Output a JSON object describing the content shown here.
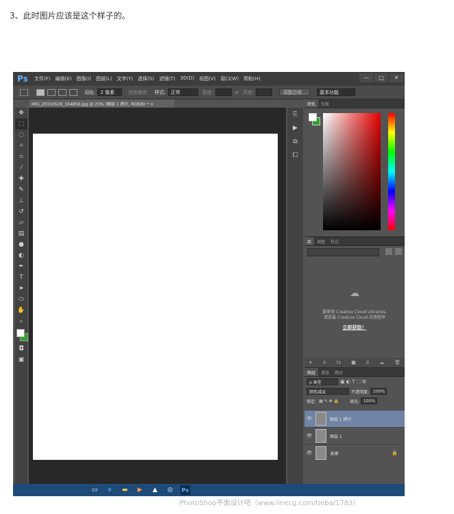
{
  "caption": "3、此时图片应该是这个样子的。",
  "app": {
    "logo": "Ps",
    "menu": [
      "文件(F)",
      "编辑(E)",
      "图像(I)",
      "图层(L)",
      "文字(Y)",
      "选择(S)",
      "滤镜(T)",
      "3D(D)",
      "视图(V)",
      "窗口(W)",
      "帮助(H)"
    ],
    "window_controls": [
      "—",
      "□",
      "✕"
    ]
  },
  "options_bar": {
    "feather_label": "羽化:",
    "feather_value": "2 像素",
    "antialias_label": "消除锯齿",
    "style_label": "样式:",
    "style_value": "正常",
    "width_label": "宽度:",
    "height_label": "高度:",
    "refine_edge": "调整边缘...",
    "workspace": "基本功能"
  },
  "document_tab": "IMG_20150526_164858.jpg @ 25% (图层 1 拷贝, RGB/8) * ×",
  "color_panel": {
    "tabs": [
      "颜色",
      "色板"
    ],
    "fg_color": "#ffffff",
    "bg_color": "#2fa32f"
  },
  "library_panel": {
    "tabs": [
      "库",
      "调整",
      "样式"
    ],
    "message_line1": "要使用 Creative Cloud Libraries,",
    "message_line2": "请安装 Creative Cloud 应用程序",
    "link": "立即获取！"
  },
  "layers_panel": {
    "tabs": [
      "图层",
      "通道",
      "路径"
    ],
    "filter_kind": "ρ 类型",
    "blend_mode": "颜色减淡",
    "opacity_label": "不透明度:",
    "opacity_value": "100%",
    "lock_label": "锁定:",
    "fill_label": "填充:",
    "fill_value": "100%",
    "layers": [
      {
        "name": "图层 1 拷贝",
        "selected": true,
        "locked": false
      },
      {
        "name": "图层 1",
        "selected": false,
        "locked": false
      },
      {
        "name": "背景",
        "selected": false,
        "locked": true
      }
    ]
  },
  "taskbar": {
    "ps_label": "Ps"
  },
  "watermark": "PhotoShop平面设计吧（www.linecg.com/tieba/1783）"
}
